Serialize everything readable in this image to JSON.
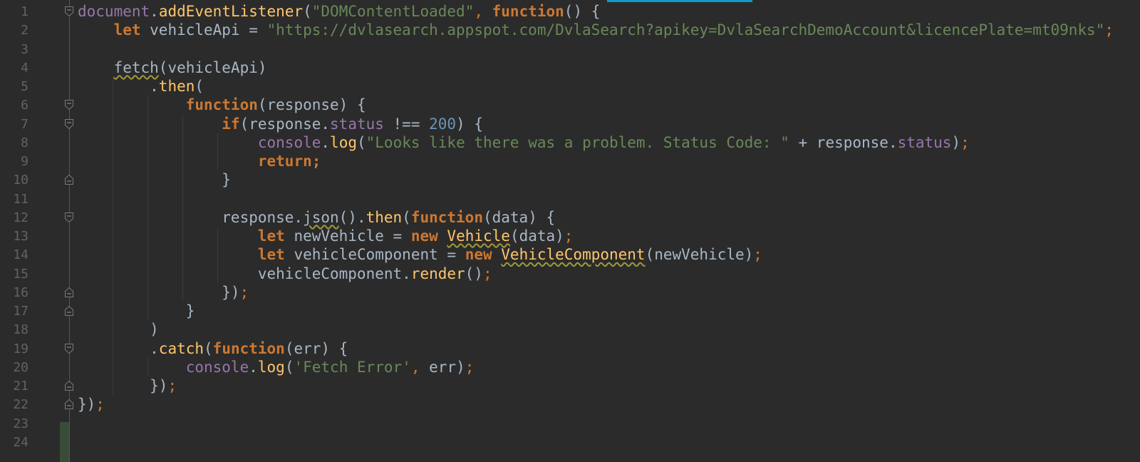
{
  "editor": {
    "language": "JavaScript",
    "colors": {
      "background": "#2b2b2b",
      "line_number": "#606366",
      "keyword": "#cc7832",
      "string": "#6a8759",
      "number": "#6897bb",
      "property": "#9876aa",
      "function": "#ffc66d",
      "default": "#a9b7c6",
      "active_tab_accent": "#0e9bc7",
      "changed_lines_marker": "#384c38"
    },
    "line_numbers": [
      "1",
      "2",
      "3",
      "4",
      "5",
      "6",
      "7",
      "8",
      "9",
      "10",
      "11",
      "12",
      "13",
      "14",
      "15",
      "16",
      "17",
      "18",
      "19",
      "20",
      "21",
      "22",
      "23",
      "24"
    ],
    "lines": [
      [
        {
          "t": "document",
          "c": "obj"
        },
        {
          "t": ".",
          "c": ""
        },
        {
          "t": "addEventListener",
          "c": "fn"
        },
        {
          "t": "(",
          "c": ""
        },
        {
          "t": "\"DOMContentLoaded\"",
          "c": "str"
        },
        {
          "t": ", ",
          "c": "op"
        },
        {
          "t": "function",
          "c": "kw"
        },
        {
          "t": "() {",
          "c": ""
        }
      ],
      [
        {
          "t": "    ",
          "c": ""
        },
        {
          "t": "let",
          "c": "kw"
        },
        {
          "t": " vehicleApi = ",
          "c": ""
        },
        {
          "t": "\"https://dvlasearch.appspot.com/DvlaSearch?apikey=DvlaSearchDemoAccount&licencePlate=mt09nks\"",
          "c": "str"
        },
        {
          "t": ";",
          "c": "op"
        }
      ],
      [],
      [
        {
          "t": "    ",
          "c": ""
        },
        {
          "t": "fetch",
          "c": "warn"
        },
        {
          "t": "(vehicleApi)",
          "c": ""
        }
      ],
      [
        {
          "t": "        .",
          "c": ""
        },
        {
          "t": "then",
          "c": "fn"
        },
        {
          "t": "(",
          "c": ""
        }
      ],
      [
        {
          "t": "            ",
          "c": ""
        },
        {
          "t": "function",
          "c": "kw"
        },
        {
          "t": "(response) {",
          "c": ""
        }
      ],
      [
        {
          "t": "                ",
          "c": ""
        },
        {
          "t": "if",
          "c": "kw"
        },
        {
          "t": "(response.",
          "c": ""
        },
        {
          "t": "status",
          "c": "obj"
        },
        {
          "t": " !== ",
          "c": ""
        },
        {
          "t": "200",
          "c": "num"
        },
        {
          "t": ") {",
          "c": ""
        }
      ],
      [
        {
          "t": "                    ",
          "c": ""
        },
        {
          "t": "console",
          "c": "obj"
        },
        {
          "t": ".",
          "c": ""
        },
        {
          "t": "log",
          "c": "fn"
        },
        {
          "t": "(",
          "c": ""
        },
        {
          "t": "\"Looks like there was a problem. Status Code: \"",
          "c": "str"
        },
        {
          "t": " + response.",
          "c": ""
        },
        {
          "t": "status",
          "c": "obj"
        },
        {
          "t": ")",
          "c": ""
        },
        {
          "t": ";",
          "c": "op"
        }
      ],
      [
        {
          "t": "                    ",
          "c": ""
        },
        {
          "t": "return;",
          "c": "kw"
        }
      ],
      [
        {
          "t": "                }",
          "c": ""
        }
      ],
      [],
      [
        {
          "t": "                response.",
          "c": ""
        },
        {
          "t": "json",
          "c": "warn"
        },
        {
          "t": "().",
          "c": ""
        },
        {
          "t": "then",
          "c": "fn"
        },
        {
          "t": "(",
          "c": ""
        },
        {
          "t": "function",
          "c": "kw"
        },
        {
          "t": "(data) {",
          "c": ""
        }
      ],
      [
        {
          "t": "                    ",
          "c": ""
        },
        {
          "t": "let",
          "c": "kw"
        },
        {
          "t": " newVehicle = ",
          "c": ""
        },
        {
          "t": "new",
          "c": "kw"
        },
        {
          "t": " ",
          "c": ""
        },
        {
          "t": "Vehicle",
          "c": "cls warn"
        },
        {
          "t": "(data)",
          "c": ""
        },
        {
          "t": ";",
          "c": "op"
        }
      ],
      [
        {
          "t": "                    ",
          "c": ""
        },
        {
          "t": "let",
          "c": "kw"
        },
        {
          "t": " vehicleComponent = ",
          "c": ""
        },
        {
          "t": "new",
          "c": "kw"
        },
        {
          "t": " ",
          "c": ""
        },
        {
          "t": "VehicleComponent",
          "c": "cls warn"
        },
        {
          "t": "(newVehicle)",
          "c": ""
        },
        {
          "t": ";",
          "c": "op"
        }
      ],
      [
        {
          "t": "                    vehicleComponent.",
          "c": ""
        },
        {
          "t": "render",
          "c": "fn"
        },
        {
          "t": "()",
          "c": ""
        },
        {
          "t": ";",
          "c": "op"
        }
      ],
      [
        {
          "t": "                })",
          "c": ""
        },
        {
          "t": ";",
          "c": "op"
        }
      ],
      [
        {
          "t": "            }",
          "c": ""
        }
      ],
      [
        {
          "t": "        )",
          "c": ""
        }
      ],
      [
        {
          "t": "        .",
          "c": ""
        },
        {
          "t": "catch",
          "c": "fn"
        },
        {
          "t": "(",
          "c": ""
        },
        {
          "t": "function",
          "c": "kw"
        },
        {
          "t": "(err) {",
          "c": ""
        }
      ],
      [
        {
          "t": "            ",
          "c": ""
        },
        {
          "t": "console",
          "c": "obj"
        },
        {
          "t": ".",
          "c": ""
        },
        {
          "t": "log",
          "c": "fn"
        },
        {
          "t": "(",
          "c": ""
        },
        {
          "t": "'Fetch Error'",
          "c": "str"
        },
        {
          "t": ", ",
          "c": "op"
        },
        {
          "t": "err)",
          "c": ""
        },
        {
          "t": ";",
          "c": "op"
        }
      ],
      [
        {
          "t": "        })",
          "c": ""
        },
        {
          "t": ";",
          "c": "op"
        }
      ],
      [
        {
          "t": "})",
          "c": ""
        },
        {
          "t": ";",
          "c": "op"
        }
      ],
      [],
      []
    ],
    "folds": [
      {
        "line": 1,
        "kind": "open"
      },
      {
        "line": 6,
        "kind": "open"
      },
      {
        "line": 7,
        "kind": "open"
      },
      {
        "line": 10,
        "kind": "close"
      },
      {
        "line": 12,
        "kind": "open"
      },
      {
        "line": 16,
        "kind": "close"
      },
      {
        "line": 17,
        "kind": "close"
      },
      {
        "line": 19,
        "kind": "open"
      },
      {
        "line": 21,
        "kind": "close"
      },
      {
        "line": 22,
        "kind": "close"
      }
    ]
  }
}
